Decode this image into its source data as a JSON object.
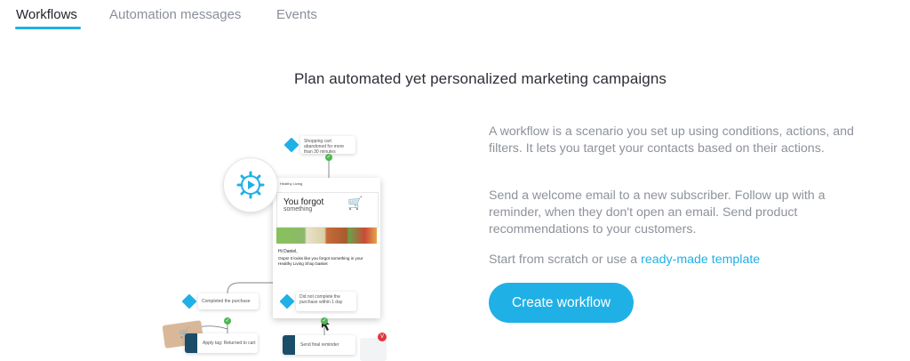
{
  "tabs": [
    {
      "label": "Workflows",
      "active": true
    },
    {
      "label": "Automation messages",
      "active": false
    },
    {
      "label": "Events",
      "active": false
    }
  ],
  "headline": "Plan automated yet personalized marketing campaigns",
  "description": {
    "p1": "A workflow is a scenario you set up using conditions, actions, and filters. It lets you target your contacts based on their actions.",
    "p2": "Send a welcome email to a new subscriber. Follow up with a reminder, when they don't open an email. Send product recommendations to your customers.",
    "p3_prefix": "Start from scratch or use a ",
    "p3_link": "ready-made template"
  },
  "cta": {
    "label": "Create workflow"
  },
  "illustration": {
    "trigger_node": "Shopping cart abandoned for more than 30 minutes",
    "email_brand": "Healthy Living",
    "email_heading": "You forgot",
    "email_subheading": "something",
    "email_greeting": "Hi Daniel,",
    "email_body": "Oops! It looks like you forgot something in your Healthy Living Shop basket",
    "node_completed": "Completed the purchase",
    "node_not_completed": "Did not complete the purchase within 1 day",
    "node_apply_tag": "Apply tag: Returned to cart",
    "node_send_reminder": "Send final reminder",
    "badge_count": "V"
  },
  "colors": {
    "accent": "#1fb0e6",
    "check": "#4cb750",
    "badge": "#e2363b"
  }
}
